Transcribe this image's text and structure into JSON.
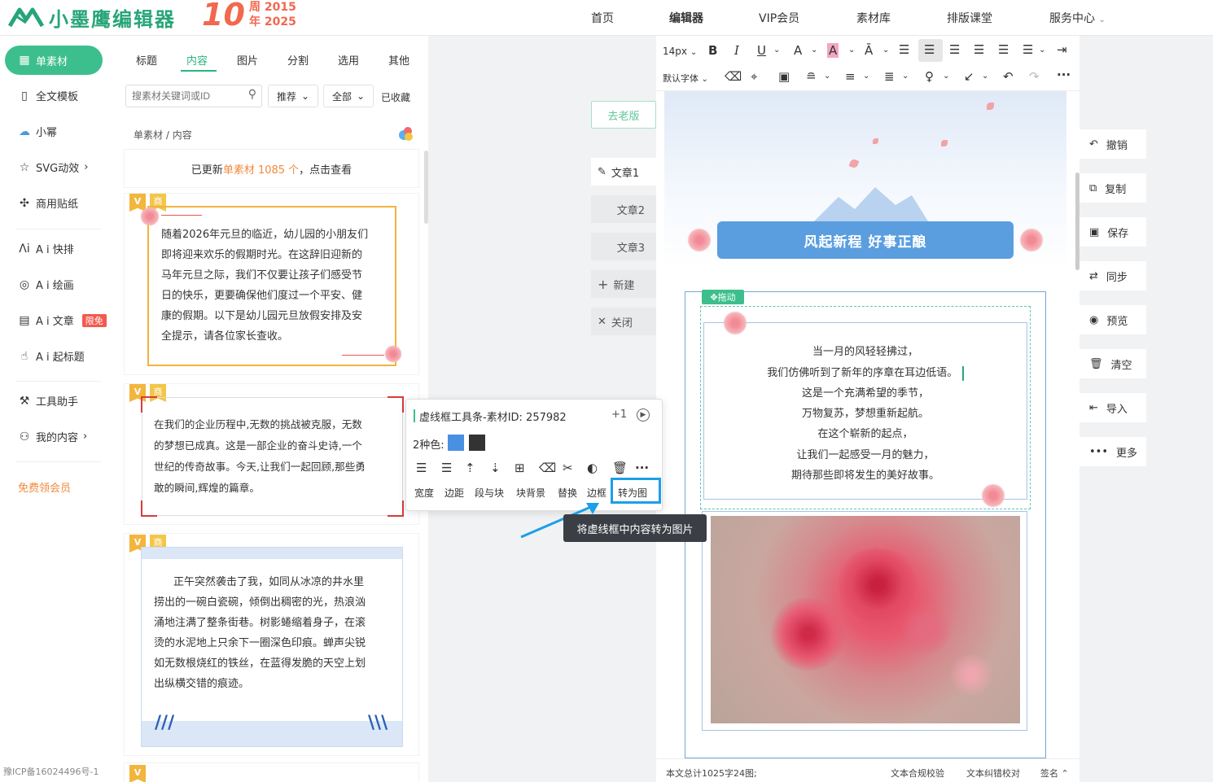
{
  "brand": {
    "name": "小墨鹰编辑器",
    "anniv_num": "10",
    "anniv_line1": "周 2015",
    "anniv_line2": "年 2025"
  },
  "topnav": [
    "首页",
    "编辑器",
    "VIP会员",
    "素材库",
    "排版课堂",
    "服务中心"
  ],
  "leftnav": {
    "active": "单素材",
    "items": [
      "全文模板",
      "小幂",
      "SVG动效",
      "商用贴纸",
      "A i 快排",
      "A i 绘画",
      "A i 文章",
      "A i 起标题",
      "工具助手",
      "我的内容"
    ],
    "ai_article_badge": "限免",
    "free_vip": "免费领会员",
    "icp": "豫ICP备16024496号-1"
  },
  "panel": {
    "tabs": [
      "标题",
      "内容",
      "图片",
      "分割",
      "选用",
      "其他"
    ],
    "active_tab": "内容",
    "search_placeholder": "搜素材关键词或ID",
    "filters": [
      "推荐",
      "全部"
    ],
    "favorites": "已收藏",
    "breadcrumb": [
      "单素材",
      "/",
      "内容"
    ],
    "update_prefix": "已更新",
    "update_highlight": "单素材 1085 个",
    "update_suffix": "，点击查看",
    "tag_v": "V",
    "tag_s": "商",
    "card1": [
      "随着2026年元旦的临近，幼儿园的小朋友们",
      "即将迎来欢乐的假期时光。在这辞旧迎新的",
      "马年元旦之际，我们不仅要让孩子们感受节",
      "日的快乐，更要确保他们度过一个平安、健",
      "康的假期。以下是幼儿园元旦放假安排及安",
      "全提示，请各位家长查收。"
    ],
    "card2": [
      "在我们的企业历程中,无数的挑战被克服，无数",
      "的梦想已成真。这是一部企业的奋斗史诗,一个",
      "世纪的传奇故事。今天,让我们一起回顾,那些勇",
      "敢的瞬间,辉煌的篇章。"
    ],
    "card3": [
      "正午突然袭击了我，如同从冰凉的井水里",
      "捞出的一碗白瓷碗，倾倒出稠密的光，热浪汹",
      "涌地注满了整条街巷。树影蜷缩着身子，在滚",
      "烫的水泥地上只余下一圈深色印痕。蝉声尖锐",
      "如无数根烧红的铁丝，在蓝得发脆的天空上划",
      "出纵横交错的痕迹。"
    ]
  },
  "middle": {
    "old_version": "去老版",
    "articles": [
      "文章1",
      "文章2",
      "文章3"
    ],
    "new": "新建",
    "close": "关闭"
  },
  "toolbar": {
    "font_size": "14px",
    "font_family": "默认字体"
  },
  "doc": {
    "banner": "风起新程 好事正酿",
    "drag": "拖动",
    "poem": [
      "当一月的风轻轻拂过，",
      "我们仿佛听到了新年的序章在耳边低语。",
      "这是一个充满希望的季节，",
      "万物复苏，梦想重新起航。",
      "在这个崭新的起点，",
      "让我们一起感受一月的魅力，",
      "期待那些即将发生的美好故事。"
    ]
  },
  "status": {
    "count": "本文总计1025字24图;",
    "check1": "文本合规校验",
    "check2": "文本纠错校对",
    "sign": "签名"
  },
  "righttools": [
    "撤销",
    "复制",
    "保存",
    "同步",
    "预览",
    "清空",
    "导入",
    "更多"
  ],
  "popup": {
    "title": "虚线框工具条-素材ID: 257982",
    "plus": "+1",
    "colors_label": "2种色:",
    "colors": [
      "#4a90e2",
      "#333333"
    ],
    "tools": [
      "宽度",
      "边距",
      "段与块",
      "块背景",
      "替换",
      "边框",
      "转为图"
    ],
    "tooltip": "将虚线框中内容转为图片"
  }
}
